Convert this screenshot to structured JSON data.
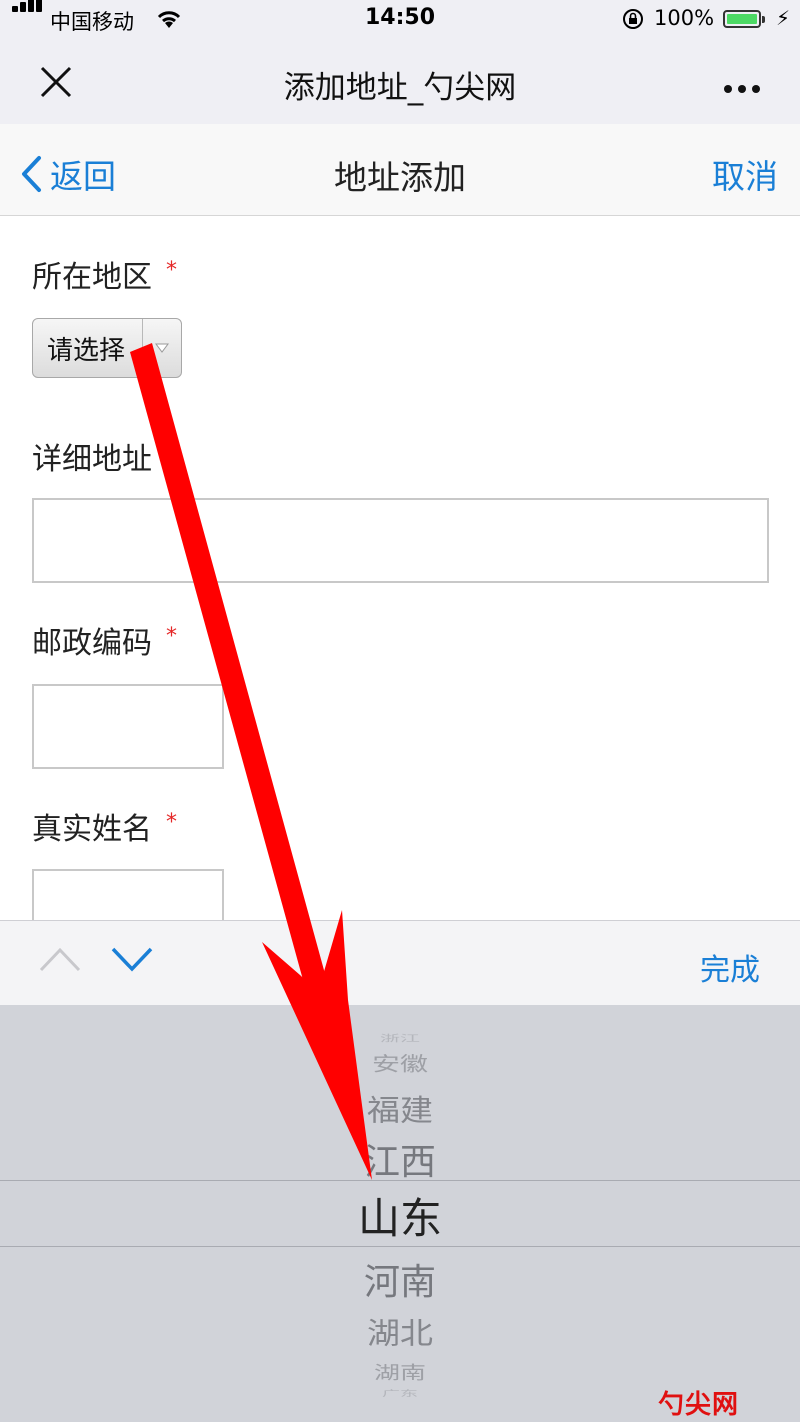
{
  "status_bar": {
    "carrier": "中国移动",
    "time": "14:50",
    "battery": "100%"
  },
  "wechat_bar": {
    "title": "添加地址_勺尖网"
  },
  "nav": {
    "back_label": "返回",
    "title": "地址添加",
    "cancel_label": "取消"
  },
  "form": {
    "region_label": "所在地区",
    "region_select_value": "请选择",
    "address_label": "详细地址",
    "postcode_label": "邮政编码",
    "name_label": "真实姓名",
    "required_mark": "*"
  },
  "accessory": {
    "done_label": "完成"
  },
  "picker": {
    "items": [
      "浙江",
      "安徽",
      "福建",
      "江西",
      "山东",
      "河南",
      "湖北",
      "湖南",
      "广东"
    ],
    "selected": "山东"
  },
  "watermark": "勺尖网",
  "colors": {
    "accent": "#1a7fd6",
    "required": "#e52828",
    "annotation_arrow": "#ff0000"
  }
}
